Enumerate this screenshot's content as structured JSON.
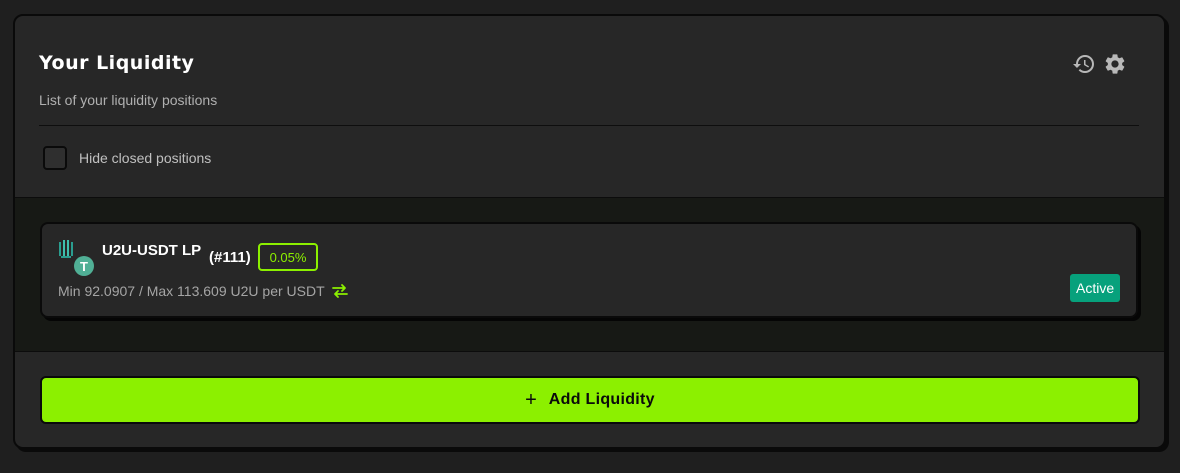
{
  "header": {
    "title": "Your Liquidity",
    "subtitle": "List of your liquidity positions",
    "history_icon": "history-icon",
    "settings_icon": "gear-icon"
  },
  "filter": {
    "hide_closed_label": "Hide closed positions",
    "hide_closed_checked": false
  },
  "positions": [
    {
      "pair": "U2U-USDT LP",
      "id": "(#111)",
      "fee": "0.05%",
      "range": "Min 92.0907 / Max 113.609 U2U per USDT",
      "status": "Active",
      "token0_icon": "u2u-logo",
      "token1_icon": "usdt-logo",
      "token1_glyph": "T"
    }
  ],
  "actions": {
    "add_liquidity_label": "Add Liquidity",
    "plus_glyph": "+"
  },
  "colors": {
    "accent": "#8cf000",
    "status_active": "#07a17c",
    "card_bg": "#272727",
    "page_bg": "#1f1f1f",
    "positions_bg": "#171915"
  }
}
